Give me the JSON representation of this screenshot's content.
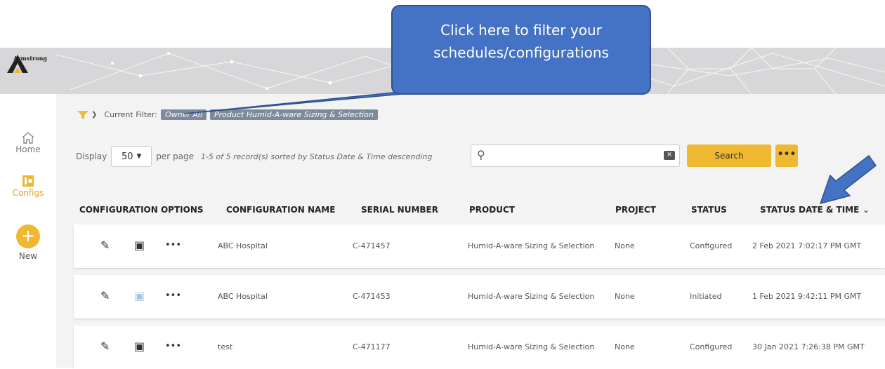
{
  "brand": {
    "logo_text": "Armstrong"
  },
  "sidebar": {
    "home": "Home",
    "configs": "Configs",
    "new": "New"
  },
  "filter": {
    "label": "Current Filter:",
    "chips": [
      "Owner  All",
      "Product  Humid-A-ware Sizing & Selection"
    ]
  },
  "controls": {
    "display_label": "Display",
    "per_page_value": "50",
    "per_page_label": "per page",
    "records_text": "1-5 of 5 record(s) sorted by Status Date & Time descending",
    "search_placeholder": "",
    "search_button": "Search",
    "more_button": "•••"
  },
  "table": {
    "headers": [
      "CONFIGURATION OPTIONS",
      "CONFIGURATION NAME",
      "SERIAL NUMBER",
      "PRODUCT",
      "PROJECT",
      "STATUS",
      "STATUS DATE & TIME"
    ],
    "rows": [
      {
        "name": "ABC Hospital",
        "serial": "C-471457",
        "product": "Humid-A-ware Sizing & Selection",
        "project": "None",
        "status": "Configured",
        "date": "2 Feb 2021 7:02:17 PM GMT"
      },
      {
        "name": "ABC Hospital",
        "serial": "C-471453",
        "product": "Humid-A-ware Sizing & Selection",
        "project": "None",
        "status": "Initiated",
        "date": "1 Feb 2021 9:42:11 PM GMT"
      },
      {
        "name": "test",
        "serial": "C-471177",
        "product": "Humid-A-ware Sizing & Selection",
        "project": "None",
        "status": "Configured",
        "date": "30 Jan 2021 7:26:38 PM GMT"
      }
    ]
  },
  "callout": {
    "line1": "Click here to filter your",
    "line2": "schedules/configurations"
  },
  "colors": {
    "accent": "#f0b731",
    "callout": "#4472c4",
    "chip": "#7d8a99"
  }
}
